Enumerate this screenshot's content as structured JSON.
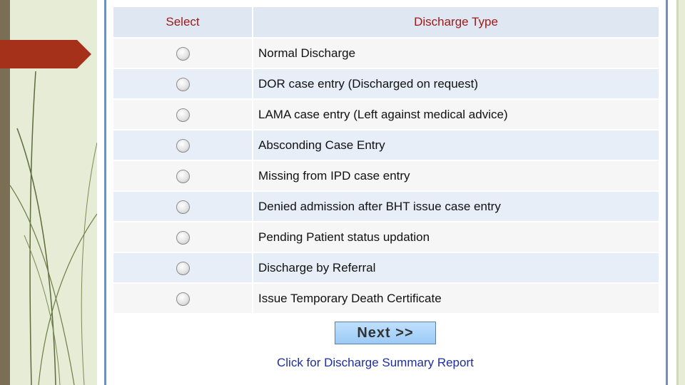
{
  "table": {
    "headers": {
      "select": "Select",
      "discharge_type": "Discharge Type"
    },
    "rows": [
      {
        "label": "Normal Discharge",
        "selected": false
      },
      {
        "label": "DOR case entry (Discharged on request)",
        "selected": false
      },
      {
        "label": "LAMA case entry (Left against medical advice)",
        "selected": false
      },
      {
        "label": "Absconding Case Entry",
        "selected": false
      },
      {
        "label": "Missing from IPD case entry",
        "selected": false
      },
      {
        "label": "Denied admission after BHT issue case entry",
        "selected": false
      },
      {
        "label": "Pending Patient status updation",
        "selected": false
      },
      {
        "label": "Discharge by Referral",
        "selected": false
      },
      {
        "label": "Issue Temporary Death Certificate",
        "selected": false
      }
    ]
  },
  "actions": {
    "next_label": "Next  >>",
    "report_link": "Click for Discharge Summary Report"
  },
  "colors": {
    "header_text": "#9b1a1a",
    "link": "#1d2f9e",
    "accent_arrow": "#a5311a"
  }
}
